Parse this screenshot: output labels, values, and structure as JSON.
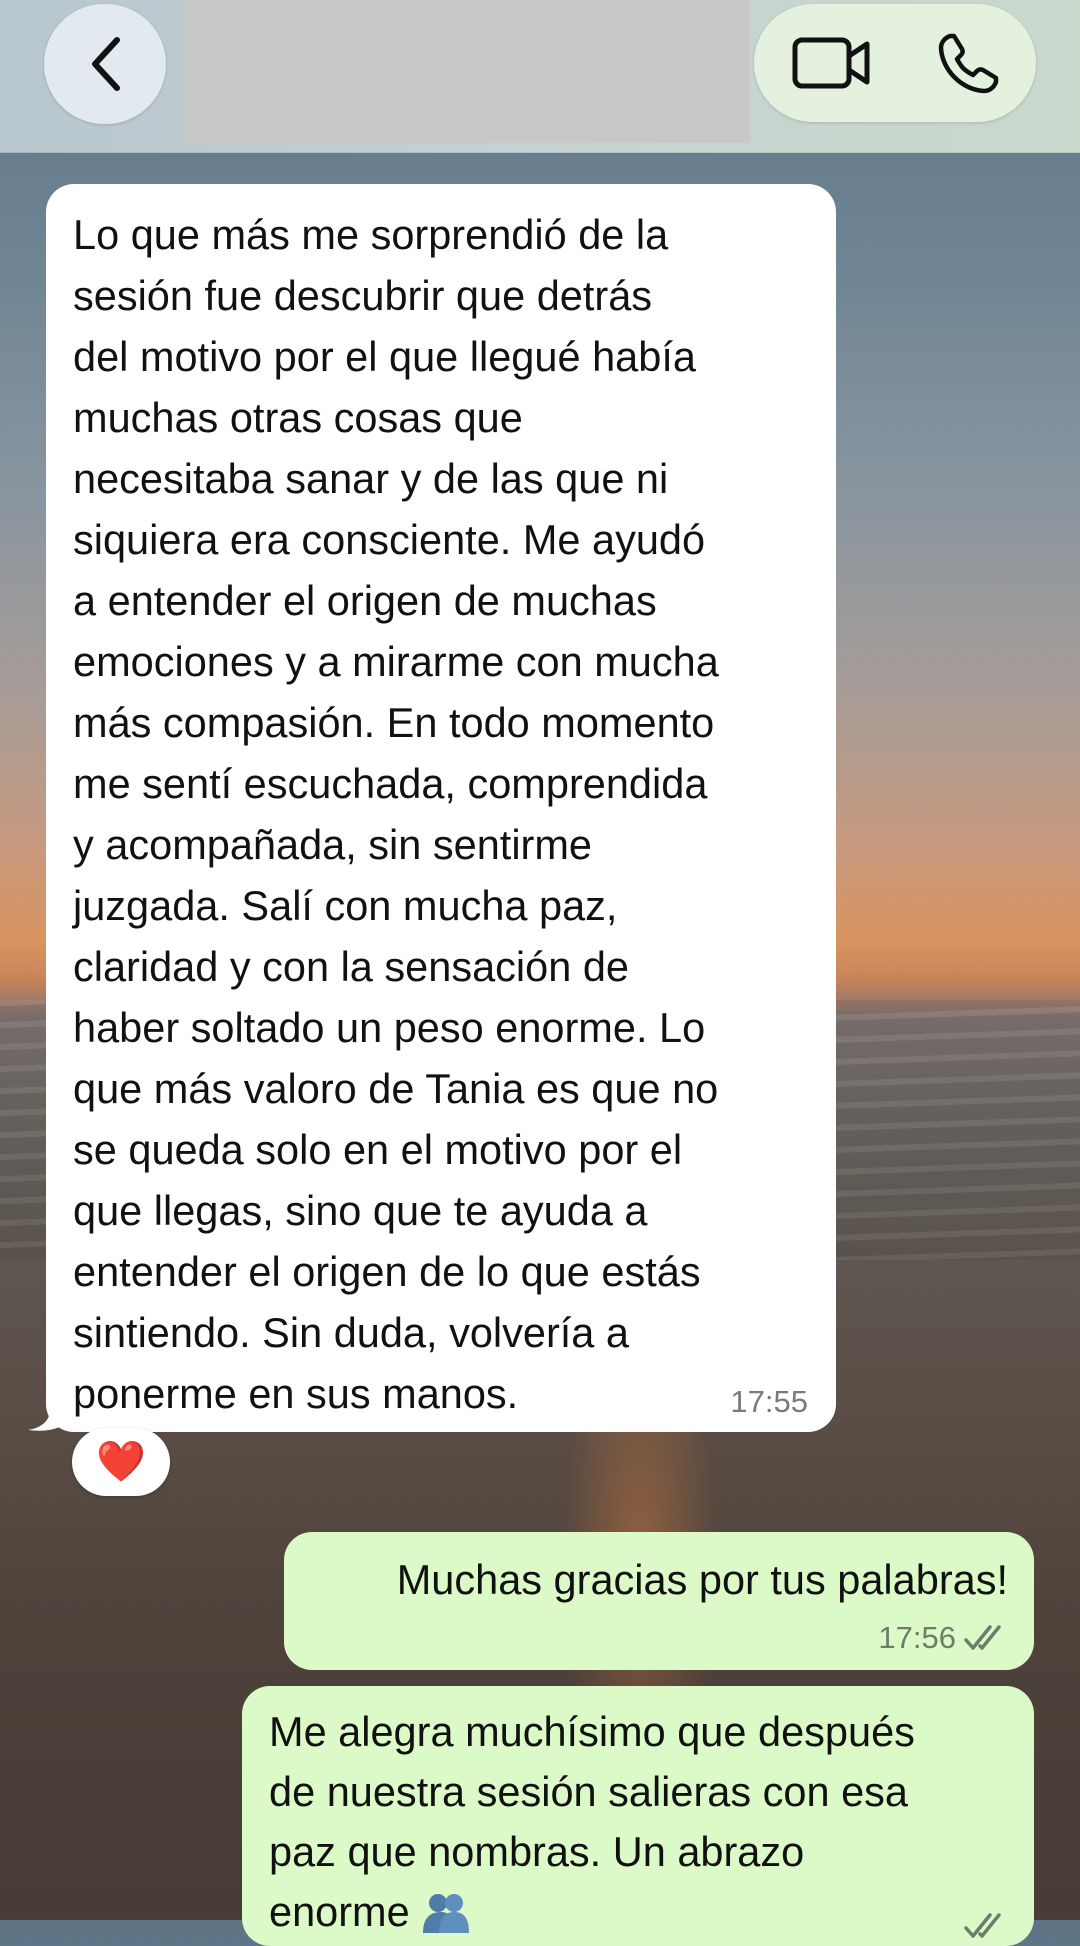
{
  "header": {
    "back_icon": "chevron-left-icon",
    "video_icon": "video-camera-icon",
    "phone_icon": "phone-icon"
  },
  "messages": {
    "incoming": {
      "text": "Lo que más me sorprendió de la\nsesión fue descubrir que detrás\ndel motivo por el que llegué había\nmuchas otras cosas que\nnecesitaba sanar y de las que ni\nsiquiera era consciente. Me ayudó\na entender el origen de muchas\nemociones y a mirarme con mucha\nmás compasión. En todo momento\nme sentí escuchada, comprendida\ny acompañada, sin sentirme\njuzgada. Salí con mucha paz,\nclaridad y con la sensación de\nhaber soltado un peso enorme. Lo\nque más valoro de Tania es que no\nse queda solo en el motivo por el\nque llegas, sino que te ayuda a\nentender el origen de lo que estás\nsintiendo. Sin duda, volvería a\nponerme en sus manos.",
      "time": "17:55",
      "reaction": "❤️"
    },
    "outgoing_1": {
      "text": "Muchas gracias por tus palabras!",
      "time": "17:56",
      "status_icon": "double-check-icon"
    },
    "outgoing_2": {
      "text": "Me alegra muchísimo que después\nde nuestra sesión salieras con esa\npaz que nombras. Un abrazo\nenorme",
      "emoji_icon": "people-hugging-icon"
    }
  },
  "colors": {
    "incoming_bubble": "#ffffff",
    "outgoing_bubble": "#dcfac8",
    "header_bg": "#c6d2d2",
    "call_pill_bg": "#e4f1de"
  }
}
